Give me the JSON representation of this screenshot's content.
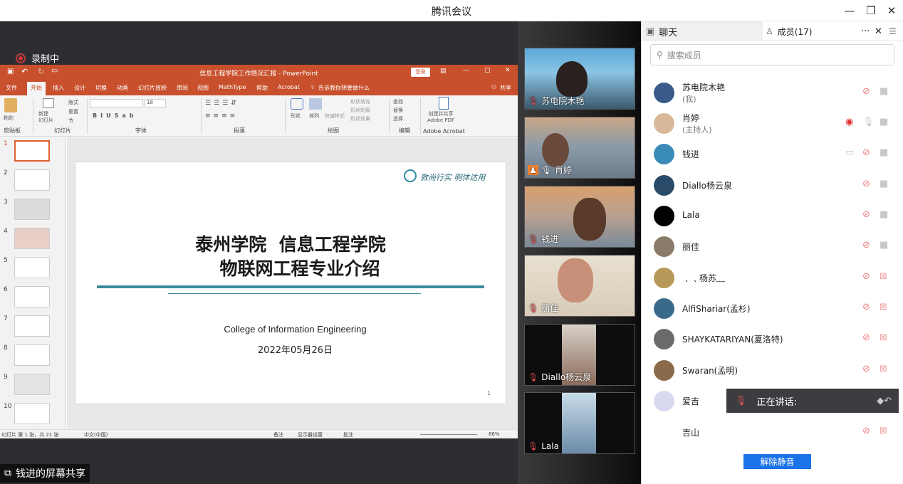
{
  "window": {
    "title": "腾讯会议"
  },
  "recording": {
    "label": "录制中"
  },
  "share_label": "钱进的屏幕共享",
  "ppt": {
    "title": "信息工程学院工作情况汇报 - PowerPoint",
    "login": "登录",
    "tabs": [
      "文件",
      "开始",
      "插入",
      "设计",
      "切换",
      "动画",
      "幻灯片放映",
      "审阅",
      "视图",
      "MathType",
      "帮助",
      "Acrobat"
    ],
    "tell_me": "告诉我你想要做什么",
    "share": "共享",
    "ribbon": {
      "paste": "粘贴",
      "clipboard": "剪贴板",
      "new_slide": "新建\n幻灯片",
      "layout": "版式",
      "reset": "重置",
      "section": "节",
      "slides": "幻灯片",
      "font_size": "18",
      "font": "字体",
      "paragraph": "段落",
      "shape": "形状",
      "arrange": "排列",
      "quick_styles": "快速样式",
      "shape_fill": "形状填充",
      "shape_outline": "形状轮廓",
      "shape_effects": "形状效果",
      "drawing": "绘图",
      "find": "查找",
      "replace": "替换",
      "select": "选择",
      "editing": "编辑",
      "create_pdf": "创建并共享\nAdobe PDF",
      "adobe": "Adobe Acrobat"
    },
    "slide_numbers": [
      "1",
      "2",
      "3",
      "4",
      "5",
      "6",
      "7",
      "8",
      "9",
      "10"
    ],
    "slide": {
      "motto": "敦尚行实 明体达用",
      "title1": "泰州学院  信息工程学院",
      "title2": "物联网工程专业介绍",
      "english": "College of Information Engineering",
      "date": "2022年05月26日",
      "page": "1"
    },
    "status": {
      "slide_info": "幻灯片 第 1 张，共 21 张",
      "language": "中文(中国)",
      "notes": "备注",
      "display": "显示器设置",
      "comments": "批注",
      "zoom": "86%"
    }
  },
  "videos": [
    {
      "name": "苏电院木艳"
    },
    {
      "name": "肖婷"
    },
    {
      "name": "钱进"
    },
    {
      "name": "丽佳"
    },
    {
      "name": "Diallo杨云泉"
    },
    {
      "name": "Lala"
    }
  ],
  "panel": {
    "chat_tab": "聊天",
    "members_tab": "成员(17)",
    "more": "···",
    "search_placeholder": "搜索成员",
    "members": [
      {
        "name": "苏电院木艳",
        "sub": "(我)"
      },
      {
        "name": "肖婷",
        "sub": "(主持人)"
      },
      {
        "name": "钱进",
        "sub": ""
      },
      {
        "name": "Diallo杨云泉",
        "sub": ""
      },
      {
        "name": "Lala",
        "sub": ""
      },
      {
        "name": "丽佳",
        "sub": ""
      },
      {
        "name": "﹑﹑杨苏﹏",
        "sub": ""
      },
      {
        "name": "AlfiShariar(孟杉)",
        "sub": ""
      },
      {
        "name": "SHAYKATARIYAN(夏洛特)",
        "sub": ""
      },
      {
        "name": "Swaran(孟明)",
        "sub": ""
      },
      {
        "name": "爱吉",
        "sub": ""
      },
      {
        "name": "吉山",
        "sub": ""
      }
    ],
    "speaking_label": "正在讲话:",
    "unmute_button": "解除静音"
  },
  "colors": {
    "ppt_brand": "#c8502c",
    "accent_blue": "#1c73e8",
    "mute_red": "#e05050"
  }
}
